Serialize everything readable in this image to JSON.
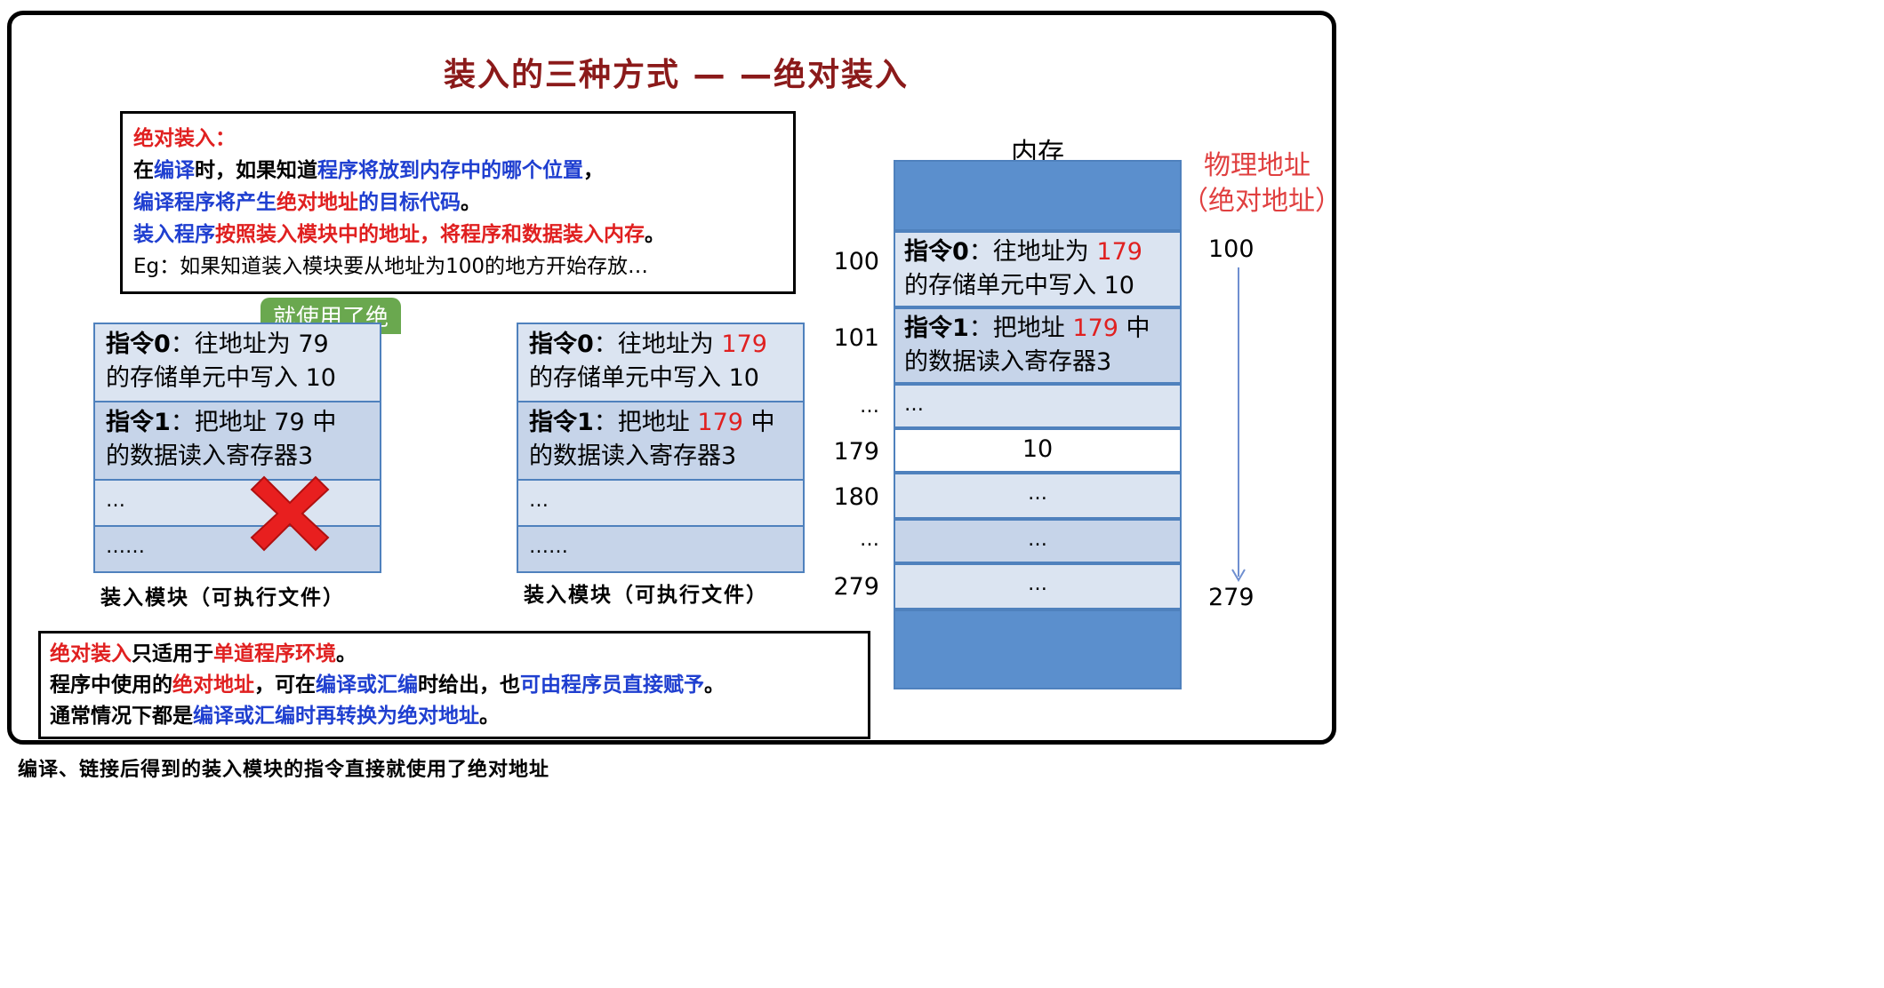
{
  "title": "装入的三种方式 — —绝对装入",
  "definition": {
    "heading": "绝对装入：",
    "line1": {
      "a": "在",
      "b": "编译",
      "c": "时，如果知道",
      "d": "程序将放到内存中的哪个位置",
      "e": "，"
    },
    "line2": {
      "a": "编译程序将产生",
      "b": "绝对地址",
      "c": "的目标代码",
      "d": "。"
    },
    "line3": {
      "a": "装入程序",
      "b": "按照装入模块中的地址，将程序和数据装入内存",
      "c": "。"
    },
    "line4": "Eg：如果知道装入模块要从地址为100的地方开始存放…"
  },
  "left_module": {
    "tab_label": "就使用了绝",
    "rows": [
      {
        "label": "指令0",
        "text_a": "：往地址为 79",
        "text_b": "的存储单元中写入 10"
      },
      {
        "label": "指令1",
        "text_a": "：把地址 79 中",
        "text_b": "的数据读入寄存器3"
      },
      {
        "text": "…"
      },
      {
        "text": "……"
      }
    ],
    "caption": "装入模块（可执行文件）"
  },
  "right_module": {
    "rows": [
      {
        "label": "指令0",
        "text_a": "：往地址为 ",
        "num": "179",
        "text_b": "的存储单元中写入 10"
      },
      {
        "label": "指令1",
        "text_a": "：把地址 ",
        "num": "179",
        "text_c": " 中",
        "text_b": "的数据读入寄存器3"
      },
      {
        "text": "…"
      },
      {
        "text": "……"
      }
    ],
    "caption": "装入模块（可执行文件）"
  },
  "memory": {
    "label": "内存",
    "physical_label": "物理地址（绝对地址）",
    "physical_line1": "物理地址",
    "physical_line2": "（绝对地址）",
    "range_start": "100",
    "range_end": "279",
    "cells": [
      {
        "addr": "100",
        "label": "指令0",
        "text_a": "：往地址为 ",
        "num": "179",
        "text_b": "的存储单元中写入 10"
      },
      {
        "addr": "101",
        "label": "指令1",
        "text_a": "：把地址 ",
        "num": "179",
        "text_c": " 中",
        "text_b": "的数据读入寄存器3"
      },
      {
        "addr": "…",
        "text": "…"
      },
      {
        "addr": "179",
        "text": "10"
      },
      {
        "addr": "180",
        "text": "…"
      },
      {
        "addr": "…",
        "text": "…"
      },
      {
        "addr": "279",
        "text": "…"
      }
    ]
  },
  "notes": {
    "line1": {
      "a": "绝对装入",
      "b": "只适用于",
      "c": "单道程序环境",
      "d": "。"
    },
    "line2": {
      "a": "程序中使用的",
      "b": "绝对地址",
      "c": "，可在",
      "d": "编译或汇编",
      "e": "时给出，也",
      "f": "可由程序员直接赋予",
      "g": "。"
    },
    "line3": {
      "a": "通常情况下都是",
      "b": "编译或汇编时再转换为绝对地址",
      "c": "。"
    }
  },
  "bottom_caption": "编译、链接后得到的装入模块的指令直接就使用了绝对地址",
  "colors": {
    "title": "#8b1a1a",
    "red": "#e02020",
    "blue": "#1f3fd0",
    "cell": "#dbe4f1",
    "cell_dark": "#c6d4e9",
    "mem_block": "#5b8fcd",
    "border": "#4f81bd",
    "cross": "#e81f1f"
  },
  "icons": {
    "wrong_mark": "red-cross-icon"
  }
}
